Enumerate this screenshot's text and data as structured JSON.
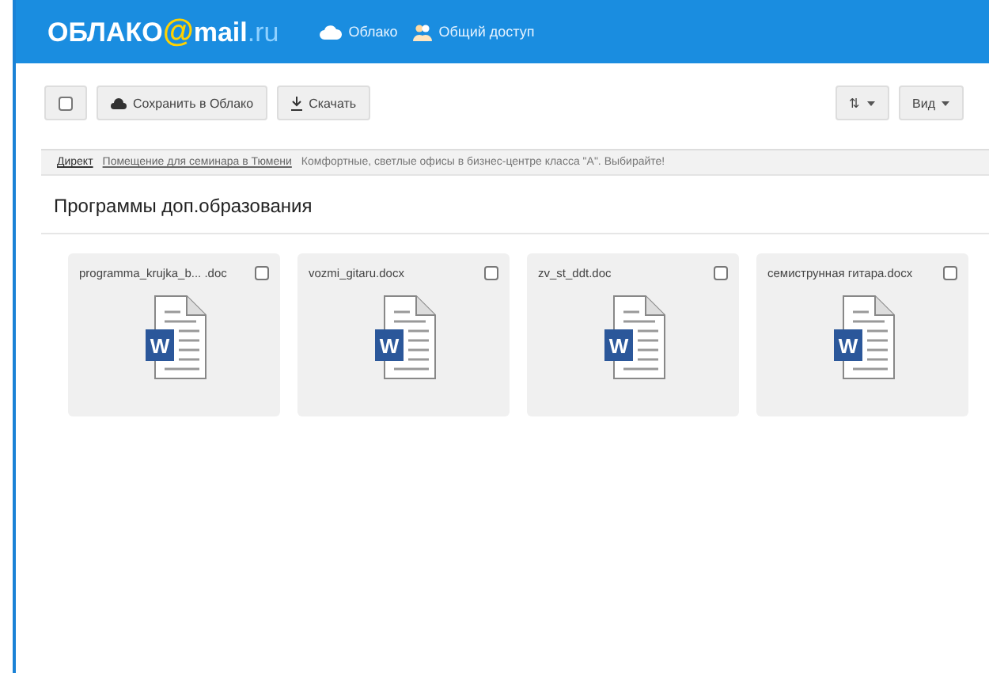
{
  "header": {
    "logo_text": "ОБЛАКО",
    "logo_at": "@",
    "logo_mail": "mail",
    "logo_domain": ".ru",
    "nav": [
      {
        "label": "Облако"
      },
      {
        "label": "Общий доступ"
      }
    ]
  },
  "toolbar": {
    "select_all": {
      "checked": false
    },
    "buttons": [
      {
        "kind": "cloud",
        "label": "Сохранить в Облако"
      },
      {
        "kind": "download",
        "label": "Скачать"
      }
    ],
    "right_buttons": [
      {
        "label": "⇅"
      },
      {
        "label": "Вид"
      }
    ]
  },
  "ad": {
    "label": "Директ",
    "link": "Помещение для семинара в Тюмени",
    "text": "Комфортные, светлые офисы в бизнес-центре класса \"А\". Выбирайте!"
  },
  "folder_title": "Программы доп.образования",
  "files": [
    {
      "name": "programma_krujka_b... .doc",
      "checked": false,
      "badge": "W"
    },
    {
      "name": "vozmi_gitaru.docx",
      "checked": false,
      "badge": "W"
    },
    {
      "name": "zv_st_ddt.doc",
      "checked": false,
      "badge": "W"
    },
    {
      "name": "семиструнная гитара.docx",
      "checked": false,
      "badge": "W"
    }
  ]
}
